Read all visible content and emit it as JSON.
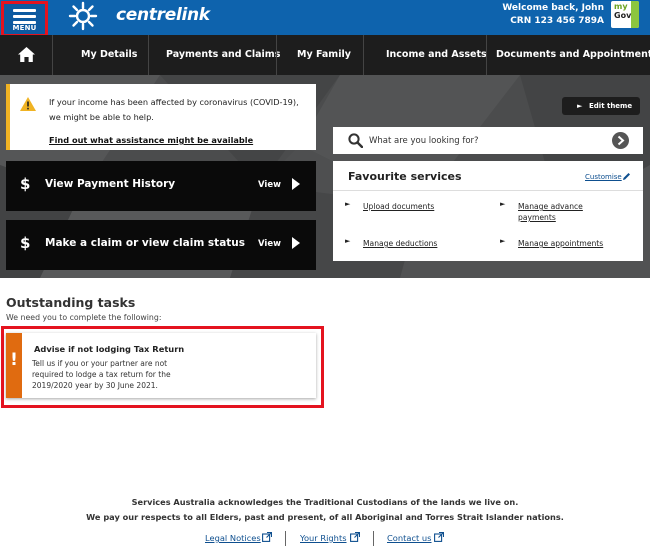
{
  "header": {
    "menu_label": "MENU",
    "brand": "centrelink",
    "welcome": "Welcome back, John",
    "crn": "CRN 123 456 789A",
    "mygov_my": "my",
    "mygov_gov": "Gov",
    "bar_color": "#0e63ad"
  },
  "nav": {
    "items": [
      "My Details",
      "Payments and Claims",
      "My Family",
      "Income and Assets",
      "Documents and Appointments"
    ]
  },
  "alert": {
    "line1": "If your income has been affected by coronavirus (COVID-19),",
    "line2": "we might be able to help.",
    "link": "Find out what assistance might be available",
    "accent_color": "#f0b323"
  },
  "edit_theme": "Edit theme",
  "search": {
    "placeholder": "What are you looking for?"
  },
  "actions": [
    {
      "title": "View Payment History",
      "cta": "View",
      "icon": "dollar-icon"
    },
    {
      "title": "Make a claim or view claim status",
      "cta": "View",
      "icon": "dollar-icon"
    }
  ],
  "favourites": {
    "title": "Favourite services",
    "customise": "Customise",
    "items": [
      {
        "label": "Upload documents"
      },
      {
        "label": "Manage advance payments"
      },
      {
        "label": "Manage deductions"
      },
      {
        "label": "Manage appointments"
      }
    ]
  },
  "tasks": {
    "title": "Outstanding tasks",
    "subtitle": "We need you to complete the following:",
    "card": {
      "heading": "Advise if not lodging Tax Return",
      "body": "Tell us if you or your partner are not required to lodge a tax return for the 2019/2020 year by 30 June 2021.",
      "accent_color": "#e06b10"
    }
  },
  "footer": {
    "ack1": "Services Australia acknowledges the Traditional Custodians of the lands we live on.",
    "ack2": "We pay our respects to all Elders, past and present, of all Aboriginal and Torres Strait Islander nations.",
    "links": [
      "Legal Notices",
      "Your Rights",
      "Contact us"
    ]
  }
}
